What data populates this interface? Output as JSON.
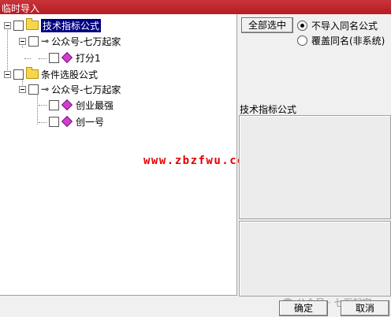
{
  "window": {
    "title": "临时导入"
  },
  "tree": {
    "nodes": [
      {
        "label": "技术指标公式",
        "selected": true
      },
      {
        "label": "公众号-七万起家"
      },
      {
        "label": "打分1"
      },
      {
        "label": "条件选股公式"
      },
      {
        "label": "公众号-七万起家"
      },
      {
        "label": "创业最强"
      },
      {
        "label": "创一号"
      }
    ]
  },
  "watermark": "www.zbzfwu.com",
  "actions": {
    "select_all": "全部选中",
    "ok": "确定",
    "cancel": "取消"
  },
  "options": {
    "no_import_same_name": "不导入同名公式",
    "overwrite_same_name": "覆盖同名(非系统)",
    "selected": "no_import_same_name"
  },
  "detail": {
    "label": "技术指标公式"
  },
  "footer_watermark": "公众号 · 七万起家"
}
